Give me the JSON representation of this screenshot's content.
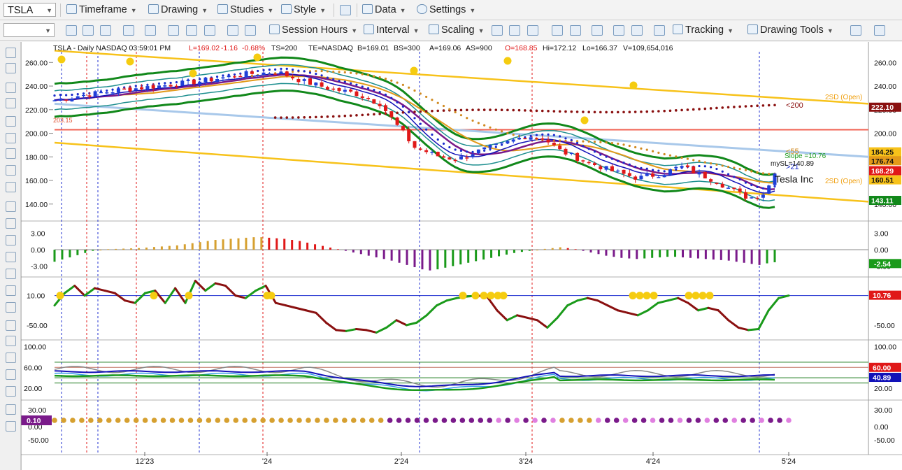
{
  "toolbar1": {
    "symbol": "TSLA",
    "items": [
      "Timeframe",
      "Drawing",
      "Studies",
      "Style",
      "Data",
      "Settings"
    ]
  },
  "toolbar2": {
    "items": [
      "Session Hours",
      "Interval",
      "Scaling",
      "Tracking",
      "Drawing Tools"
    ]
  },
  "colors": {
    "up": "#1f3fd8",
    "down": "#e01818",
    "envelope": "#11881a",
    "maBlue": "#1212b8",
    "maPurple": "#7a1a8a",
    "maOrange": "#e39a1a",
    "maTeal": "#1e8f8f",
    "channel": "#f7c21a",
    "dots200": "#8a1010",
    "dots55": "#d08a20",
    "dots21": "#1a2acc",
    "resistance": "#f06050",
    "trendBlue": "#a8c8ea",
    "positive": "#d6a030",
    "negative": "#7a1a8a",
    "green": "#1a9a1a",
    "red": "#e01818",
    "rsiGreen": "#1a9a1a",
    "rsiRed": "#8a1010",
    "marker": "#f5cc10"
  },
  "chart_data": {
    "type": "line",
    "title": "TSLA - Daily",
    "header": {
      "title": "TSLA - Daily  NASDAQ  03:59:01 PM",
      "low": "L=169.02",
      "chg": "-1.16",
      "pct": "-0.68%",
      "ts": "TS=200",
      "te": "TE=NASDAQ",
      "bid": "B=169.01",
      "bs": "BS=300",
      "ask": "A=169.06",
      "as": "AS=900",
      "open": "O=168.85",
      "high": "Hi=172.12",
      "lo": "Lo=166.37",
      "vol": "V=109,654,016"
    },
    "x_labels": [
      "12'23",
      "'24",
      "2'24",
      "3'24",
      "4'24",
      "5'24"
    ],
    "price": {
      "ticks": [
        "260.00",
        "240.00",
        "220.00",
        "200.00",
        "180.00",
        "160.00",
        "140.00"
      ],
      "range": [
        128,
        275
      ],
      "resistance": 203,
      "start_price": 228,
      "end_price": 168,
      "sma200": {
        "start": 212,
        "end": 222
      },
      "channel_upper": {
        "start": 270,
        "end": 225
      },
      "channel_lower": {
        "start": 192,
        "end": 142
      },
      "trend_blue": {
        "start": 225,
        "end": 180
      },
      "labels": {
        "sd_open_upper": "2SD (Open)",
        "sd_open_lower": "2SD (Open)",
        "ma200": "<200",
        "ma55": "<55",
        "ma21": ">21",
        "slope": "Slope =10.76",
        "mysl": "mySL=140.89",
        "name": "Tesla Inc",
        "start_tag": "203.15"
      },
      "badges": [
        "222.10",
        "184.25",
        "176.74",
        "168.29",
        "160.51",
        "143.11"
      ]
    },
    "macd": {
      "ticks": [
        "3.00",
        "0.00",
        "-3.00"
      ],
      "range": [
        -5,
        4.5
      ],
      "badge": "-2.54",
      "values": [
        -2.2,
        -1.8,
        -1.4,
        -1.0,
        -0.6,
        -0.2,
        0.0,
        0.1,
        0.15,
        0.2,
        0.25,
        0.3,
        0.4,
        0.5,
        0.6,
        0.7,
        0.8,
        1.0,
        1.2,
        1.4,
        1.6,
        1.8,
        1.9,
        2.0,
        2.1,
        2.2,
        2.3,
        2.3,
        2.2,
        2.1,
        2.0,
        1.8,
        1.6,
        1.3,
        1.0,
        0.7,
        0.4,
        0.1,
        -0.2,
        -0.5,
        -0.8,
        -1.1,
        -1.4,
        -1.7,
        -2.0,
        -2.4,
        -2.8,
        -3.2,
        -3.6,
        -3.8,
        -3.6,
        -3.3,
        -3.0,
        -2.7,
        -2.4,
        -2.1,
        -1.8,
        -1.5,
        -1.2,
        -0.9,
        -0.6,
        -0.4,
        -0.2,
        0.0,
        0.15,
        0.3,
        0.45,
        0.3,
        0.1,
        -0.2,
        -0.5,
        -0.8,
        -1.1,
        -1.3,
        -1.5,
        -1.6,
        -1.7,
        -1.6,
        -1.5,
        -1.4,
        -1.3,
        -1.3,
        -1.4,
        -1.5,
        -1.6,
        -1.7,
        -1.8,
        -1.9,
        -2.0,
        -2.2,
        -2.4,
        -2.6,
        -2.8,
        -2.5,
        -2.3
      ]
    },
    "rsi": {
      "ticks": [
        "10.00",
        "-50.00"
      ],
      "range": [
        -80,
        45
      ],
      "badge": "10.76",
      "values": [
        -10,
        15,
        30,
        10,
        25,
        20,
        15,
        0,
        -5,
        15,
        20,
        -5,
        25,
        -5,
        40,
        20,
        35,
        30,
        10,
        5,
        20,
        30,
        -5,
        -10,
        -15,
        -20,
        -25,
        -45,
        -60,
        -62,
        -58,
        -60,
        -65,
        -55,
        -40,
        -50,
        -45,
        -30,
        -10,
        0,
        5,
        8,
        10,
        8,
        -20,
        -40,
        -30,
        -35,
        -40,
        -55,
        -35,
        -10,
        0,
        5,
        0,
        -10,
        -20,
        -25,
        -30,
        -20,
        -5,
        0,
        5,
        -5,
        -20,
        -15,
        -20,
        -40,
        -55,
        -60,
        -58,
        -20,
        5,
        10
      ]
    },
    "stoch": {
      "ticks": [
        "100.00",
        "60.00",
        "20.00"
      ],
      "range": [
        0,
        110
      ],
      "badges": [
        "60.00",
        "40.89"
      ],
      "levels": [
        70,
        60,
        40,
        30
      ]
    },
    "bottom": {
      "ticks": [
        "30.00",
        "0.00",
        "-50.00"
      ],
      "badge": "0.10",
      "dot_count": 82
    }
  }
}
